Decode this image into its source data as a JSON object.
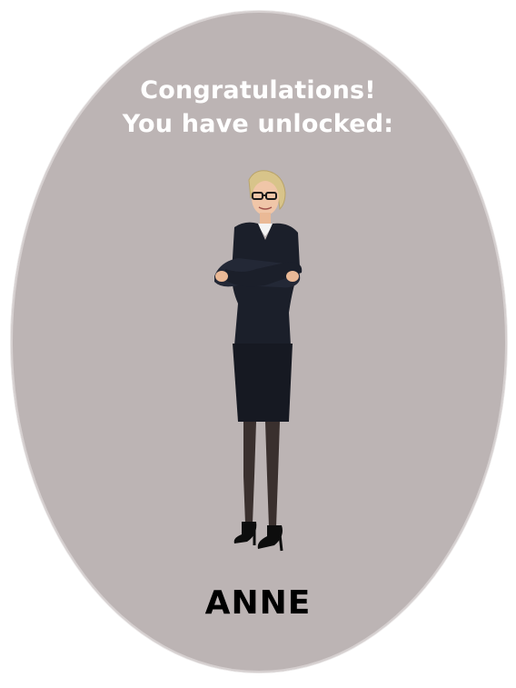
{
  "card": {
    "headline_line1": "Congratulations!",
    "headline_line2": "You have unlocked:",
    "character_name": "ANNE",
    "character_image": "businesswoman-standing-arms-crossed",
    "colors": {
      "oval_background": "#bcb4b4",
      "headline_text": "#ffffff",
      "name_text": "#000000"
    }
  }
}
